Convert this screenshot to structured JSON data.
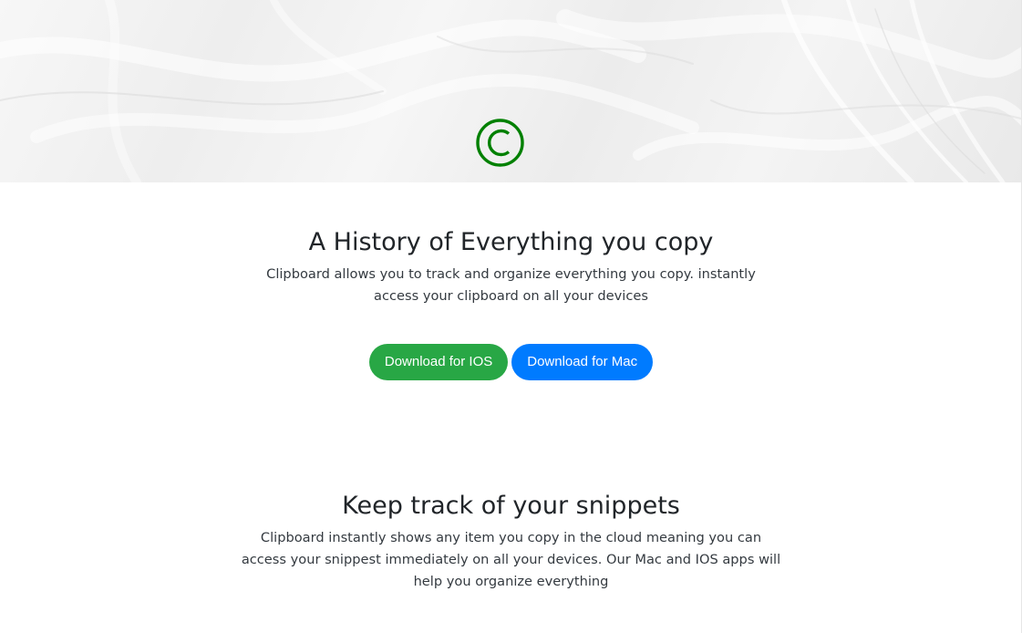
{
  "brand": {
    "logo_glyph": "©",
    "logo_color": "#008000"
  },
  "hero_section": {
    "title": "A History of Everything you copy",
    "description": "Clipboard allows you to track and organize everything you copy. instantly access your clipboard on all your devices"
  },
  "downloads": {
    "ios_label": "Download for IOS",
    "ios_color": "#28a745",
    "mac_label": "Download for Mac",
    "mac_color": "#007bff"
  },
  "snippets_section": {
    "title": "Keep track of your snippets",
    "description": "Clipboard instantly shows any item you copy in the cloud meaning you can access your snippest immediately on all your devices. Our Mac and IOS apps will help you organize everything"
  }
}
